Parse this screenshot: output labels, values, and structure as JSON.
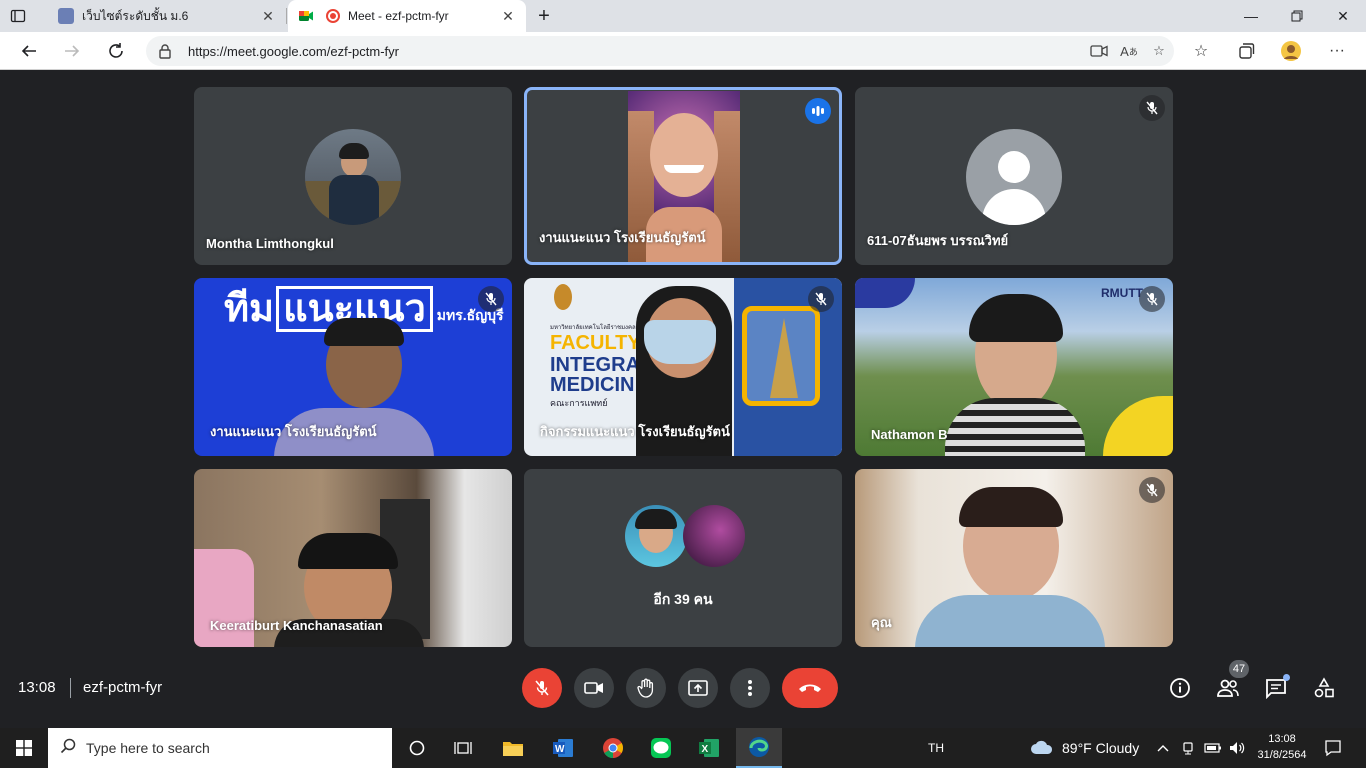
{
  "browser": {
    "tabs": [
      {
        "title": "เว็บไซต์ระดับชั้น ม.6"
      },
      {
        "title": "Meet - ezf-pctm-fyr"
      }
    ],
    "url": "https://meet.google.com/ezf-pctm-fyr"
  },
  "meet": {
    "participants": [
      {
        "name": "Montha Limthongkul",
        "muted": false
      },
      {
        "name": "งานแนะแนว โรงเรียนธัญรัตน์",
        "muted": false,
        "speaking": true
      },
      {
        "name": "611-07ธันยพร บรรณวิทย์",
        "muted": true
      },
      {
        "name": "งานแนะแนว โรงเรียนธัญรัตน์",
        "muted": true
      },
      {
        "name": "กิจกรรมแนะแนว โรงเรียนธัญรัตน์",
        "muted": true
      },
      {
        "name": "Nathamon B",
        "muted": true
      },
      {
        "name": "Keeratiburt Kanchanasatian",
        "muted": false
      },
      {
        "name": "อีก 39 คน",
        "muted": false
      },
      {
        "name": "คุณ",
        "muted": true
      }
    ],
    "banner": {
      "team_text": "ทีม",
      "team_box_text": "แนะแนว",
      "school_text": "มทร.ธัญบุรี"
    },
    "slide": {
      "line1": "FACULTY",
      "line2": "INTEGRA",
      "line3": "MEDICIN",
      "thai": "คณะการแพทย์",
      "header": "มหาวิทยาลัยเทคโนโลยีราชมงคล"
    },
    "rmutt_logo": "RMUTT",
    "time": "13:08",
    "meeting_code": "ezf-pctm-fyr",
    "people_count": "47"
  },
  "taskbar": {
    "search_placeholder": "Type here to search",
    "lang": "TH",
    "weather": "89°F  Cloudy",
    "time": "13:08",
    "date": "31/8/2564"
  },
  "colors": {
    "meet_bg": "#202124",
    "tile_bg": "#3c4043",
    "red": "#ea4335",
    "speaking_border": "#8ab4f8",
    "banner_blue": "#1d3fd6"
  }
}
